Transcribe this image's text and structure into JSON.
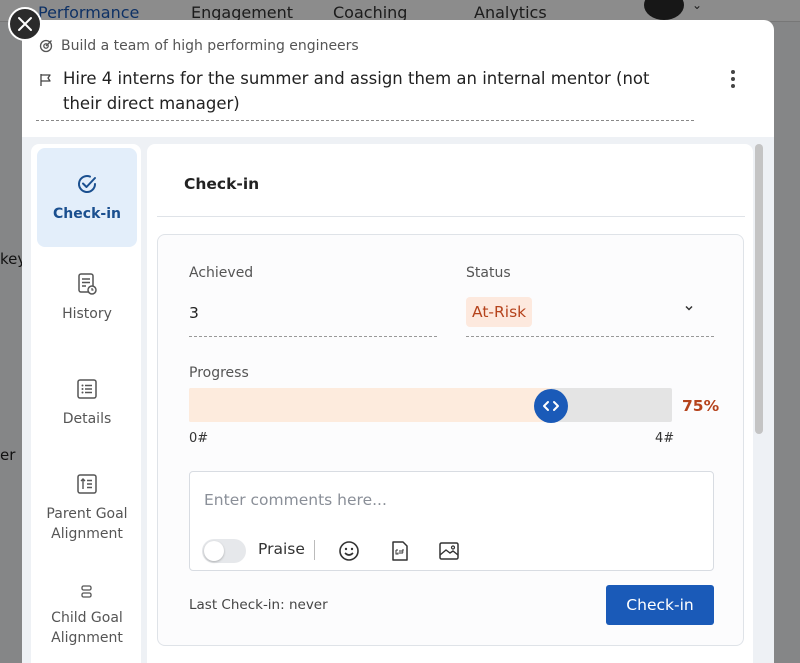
{
  "background": {
    "nav": [
      "Performance",
      "Engagement",
      "Coaching",
      "Analytics"
    ],
    "left_fragments": [
      "key",
      "er"
    ]
  },
  "header": {
    "parent_goal": "Build a team of high performing engineers",
    "goal_title": "Hire 4 interns for the summer and assign them an internal mentor (not their direct manager)"
  },
  "sidebar": {
    "items": [
      {
        "label": "Check-in",
        "icon": "check-circle-icon",
        "active": true
      },
      {
        "label": "History",
        "icon": "history-icon"
      },
      {
        "label": "Details",
        "icon": "list-icon"
      },
      {
        "label": "Parent Goal Alignment",
        "icon": "parent-alignment-icon"
      },
      {
        "label": "Child Goal Alignment",
        "icon": "child-alignment-icon"
      }
    ]
  },
  "checkin": {
    "title": "Check-in",
    "achieved_label": "Achieved",
    "achieved_value": "3",
    "status_label": "Status",
    "status_value": "At-Risk",
    "progress_label": "Progress",
    "progress_fraction": 0.75,
    "progress_pct": "75%",
    "progress_min": "0#",
    "progress_max": "4#",
    "comment_placeholder": "Enter comments here...",
    "praise_label": "Praise",
    "last_checkin": "Last Check-in: never",
    "button_label": "Check-in"
  },
  "colors": {
    "accent": "#1a5ab8",
    "at_risk_text": "#b5431c",
    "at_risk_bg": "#fde9de",
    "progress_fill": "#fdebdd"
  }
}
